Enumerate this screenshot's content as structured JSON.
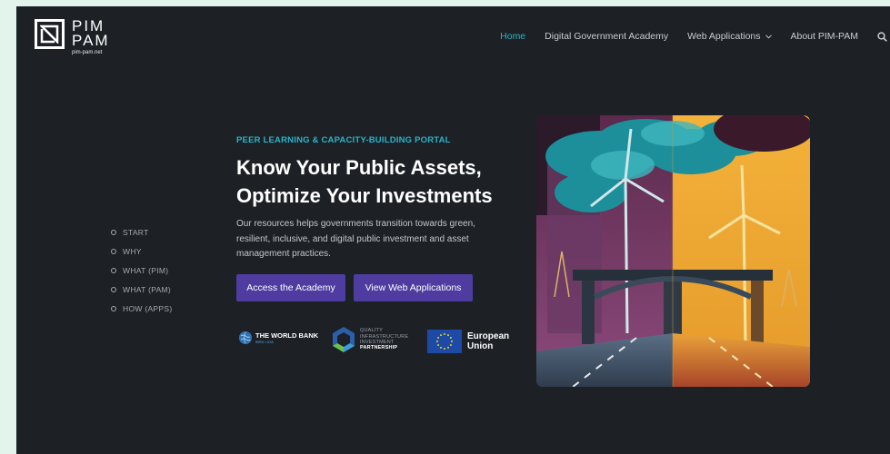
{
  "brand": {
    "line1": "PIM",
    "line2": "PAM",
    "url": "pim-pam.net"
  },
  "nav": {
    "items": [
      {
        "label": "Home",
        "active": true
      },
      {
        "label": "Digital Government Academy"
      },
      {
        "label": "Web Applications",
        "dropdown": true
      },
      {
        "label": "About PIM-PAM"
      }
    ],
    "search_icon": "search-icon"
  },
  "side_nav": {
    "items": [
      "START",
      "WHY",
      "WHAT (PIM)",
      "WHAT (PAM)",
      "HOW (APPS)"
    ]
  },
  "hero": {
    "eyebrow": "PEER LEARNING & CAPACITY-BUILDING PORTAL",
    "headline_line1": "Know Your Public Assets,",
    "headline_line2": "Optimize Your Investments",
    "body": "Our resources helps governments transition towards green, resilient, inclusive, and digital public investment and asset management practices.",
    "primary_button": "Access the Academy",
    "secondary_button": "View Web Applications"
  },
  "partners": {
    "world_bank": {
      "name": "THE WORLD BANK",
      "sub": "IBRD • IDA"
    },
    "qii": {
      "line1": "QUALITY",
      "line2": "INFRASTRUCTURE",
      "line3": "INVESTMENT",
      "line4": "PARTNERSHIP"
    },
    "eu": {
      "line1": "European",
      "line2": "Union"
    }
  },
  "colors": {
    "page_bg": "#1d2126",
    "outer_bg": "#e3f4ec",
    "accent": "#2bb3c7",
    "button": "#4e3ca0"
  }
}
